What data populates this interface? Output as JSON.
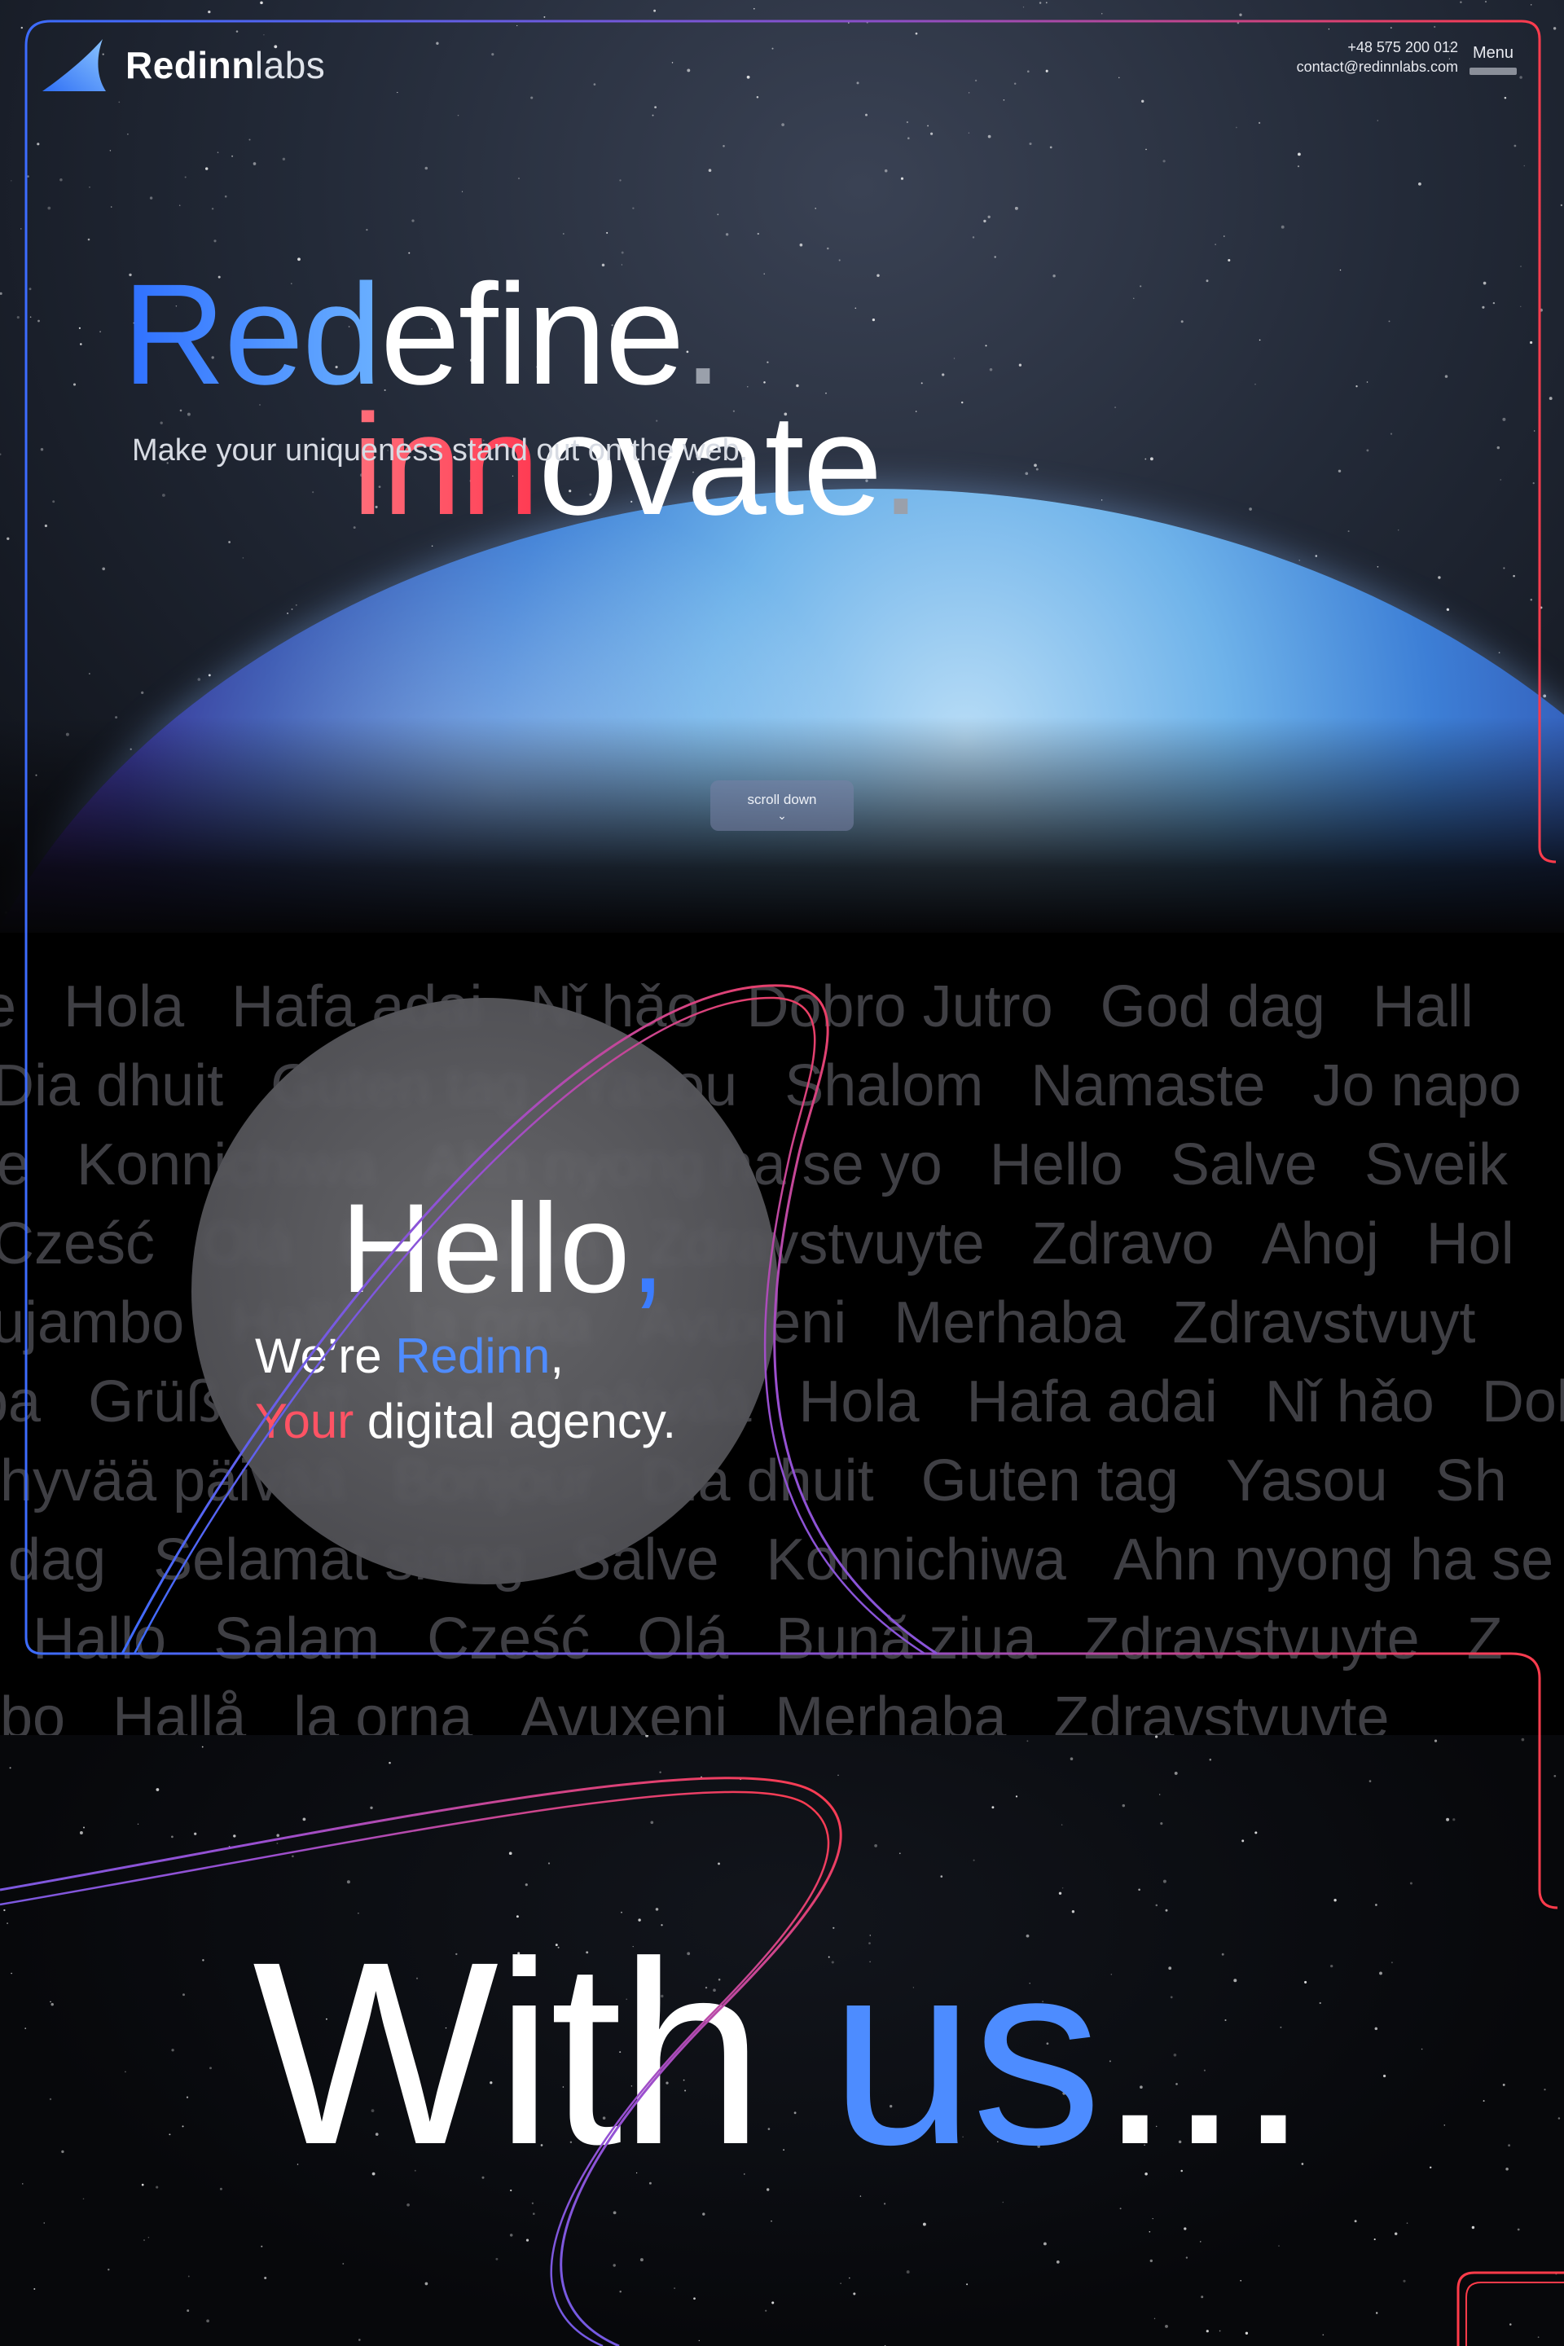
{
  "header": {
    "logo_bold": "Redinn",
    "logo_light": "labs",
    "phone": "+48 575 200 012",
    "email": "contact@redinnlabs.com",
    "menu_label": "Menu"
  },
  "hero": {
    "line1_accent": "Red",
    "line1_rest": "efine",
    "line2_accent": "inn",
    "line2_rest": "ovate",
    "period": ".",
    "tagline": "Make your uniqueness stand out on the web.",
    "scroll_label": "scroll down"
  },
  "greetings": {
    "rows": [
      [
        "e",
        "Hola",
        "Hafa adai",
        "Nǐ hǎo",
        "Dobro Jutro",
        "God dag",
        "Hall"
      ],
      [
        "Dia dhuit",
        "Guten tag",
        "Yasou",
        "Shalom",
        "Namaste",
        "Jo napo"
      ],
      [
        "ve",
        "Konnichiwa",
        "Ahn nyong ha se yo",
        "Hello",
        "Salve",
        "Sveik"
      ],
      [
        "Cześć",
        "Olá",
        "Bună ziua",
        "Zdravstvuyte",
        "Zdravo",
        "Ahoj",
        "Hol"
      ],
      [
        "ujambo",
        "Hallå",
        "la orna",
        "Avuxeni",
        "Merhaba",
        "Zdravstvuyt"
      ],
      [
        "ba",
        "Grüß Gott",
        "Hyvää päivää",
        "Hola",
        "Hafa adai",
        "Nǐ hǎo",
        "Dob"
      ],
      [
        "hyvää päivää",
        "Bonjour",
        "Dia dhuit",
        "Guten tag",
        "Yasou",
        "Sh"
      ],
      [
        "dag",
        "Selamat siang",
        "Salve",
        "Konnichiwa",
        "Ahn nyong ha se"
      ],
      [
        "Hallo",
        "Salam",
        "Cześć",
        "Olá",
        "Bună ziua",
        "Zdravstvuyte",
        "Z"
      ],
      [
        "bo",
        "Hallå",
        "la orna",
        "Avuxeni",
        "Merhaba",
        "Zdravstvuyte"
      ]
    ]
  },
  "intro": {
    "hello": "Hello",
    "comma": ",",
    "were": "We’re ",
    "brand": "Redinn",
    "brand_comma": ",",
    "your": "Your",
    "agency": " digital agency."
  },
  "closing": {
    "with": "With ",
    "us": "us",
    "ellipsis": "..."
  },
  "colors": {
    "blue_accent": "#4d8cff",
    "red_accent": "#ff5364",
    "background": "#050507"
  }
}
